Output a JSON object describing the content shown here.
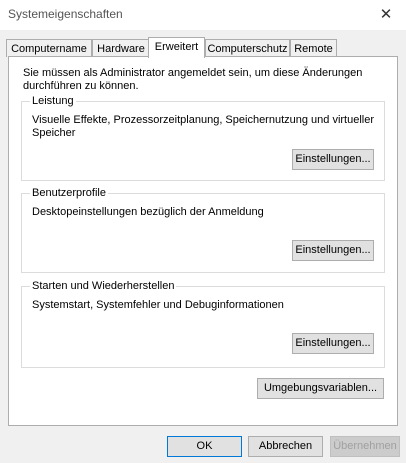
{
  "window": {
    "title": "Systemeigenschaften",
    "close_glyph": "✕"
  },
  "tabs": [
    {
      "label": "Computername"
    },
    {
      "label": "Hardware"
    },
    {
      "label": "Erweitert"
    },
    {
      "label": "Computerschutz"
    },
    {
      "label": "Remote"
    }
  ],
  "active_tab": "Erweitert",
  "intro_text": "Sie müssen als Administrator angemeldet sein, um diese Änderungen durchführen zu können.",
  "groups": {
    "performance": {
      "title": "Leistung",
      "description": "Visuelle Effekte, Prozessorzeitplanung, Speichernutzung und virtueller Speicher",
      "button": "Einstellungen..."
    },
    "user_profiles": {
      "title": "Benutzerprofile",
      "description": "Desktopeinstellungen bezüglich der Anmeldung",
      "button": "Einstellungen..."
    },
    "startup_recovery": {
      "title": "Starten und Wiederherstellen",
      "description": "Systemstart, Systemfehler und Debuginformationen",
      "button": "Einstellungen..."
    }
  },
  "env_button": "Umgebungsvariablen...",
  "footer": {
    "ok": "OK",
    "cancel": "Abbrechen",
    "apply": "Übernehmen"
  }
}
